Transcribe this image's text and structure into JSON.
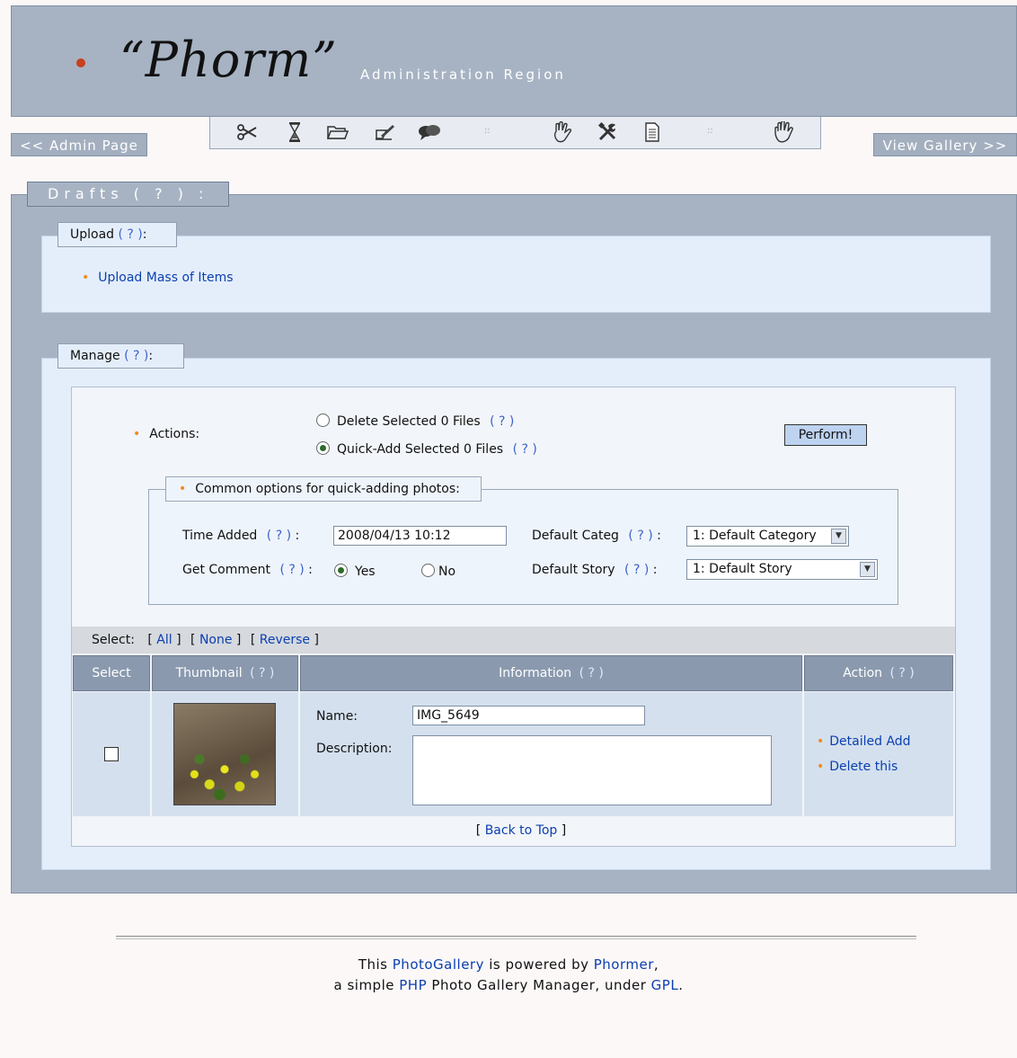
{
  "header": {
    "logo": "“Phorm”",
    "subtitle": "Administration Region"
  },
  "nav": {
    "admin_page": "<< Admin Page",
    "view_gallery": "View Gallery >>"
  },
  "toolbar": {
    "icons": [
      "scissors-icon",
      "hourglass-icon",
      "folder-icon",
      "pen-icon",
      "chat-icon",
      "hand-ok-icon",
      "tools-icon",
      "document-icon",
      "hand-stop-icon"
    ],
    "separator": "::"
  },
  "drafts": {
    "title": "Drafts ( ? ) :"
  },
  "upload": {
    "legend": "Upload",
    "help": "( ? )",
    "colon": ":",
    "link": "Upload Mass of Items"
  },
  "manage": {
    "legend": "Manage",
    "help": "( ? )",
    "colon": ":",
    "actions_label": "Actions:",
    "action_delete": "Delete Selected 0 Files",
    "action_quickadd": "Quick-Add Selected 0 Files",
    "help_q": "( ? )",
    "perform": "Perform!",
    "common_legend": "Common options for quick-adding photos:",
    "time_added_label": "Time Added",
    "time_added_value": "2008/04/13 10:12",
    "get_comment_label": "Get Comment",
    "yes": "Yes",
    "no": "No",
    "default_categ_label": "Default Categ",
    "default_categ_value": "1: Default Category",
    "default_story_label": "Default Story",
    "default_story_value": "1: Default Story"
  },
  "select_bar": {
    "label": "Select:",
    "all": "All",
    "none": "None",
    "reverse": "Reverse"
  },
  "table": {
    "headers": {
      "select": "Select",
      "thumbnail": "Thumbnail",
      "information": "Information",
      "action": "Action"
    },
    "row": {
      "name_label": "Name:",
      "name_value": "IMG_5649",
      "description_label": "Description:",
      "detailed_add": "Detailed Add",
      "delete_this": "Delete this"
    },
    "back_to_top": "Back to Top"
  },
  "footer": {
    "line1_pre": "This",
    "photogallery": "PhotoGallery",
    "line1_mid": "is powered by",
    "phormer": "Phormer",
    "line2_pre": "a simple",
    "php": "PHP",
    "line2_mid": "Photo Gallery Manager, under",
    "gpl": "GPL"
  },
  "colors": {
    "header_bg": "#a7b3c3",
    "panel_bg": "#e4eefb",
    "link": "#0b3fb0",
    "bullet": "#f08a1c",
    "button_bg": "#bdd3f0"
  }
}
